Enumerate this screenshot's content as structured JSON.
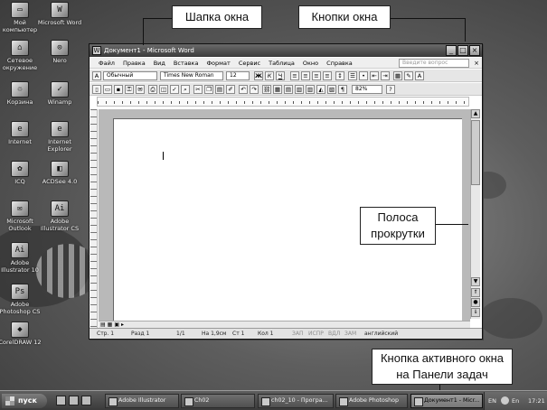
{
  "desktop": {
    "icons": [
      {
        "label": "Мой компьютер",
        "glyph": "▭"
      },
      {
        "label": "Microsoft Word",
        "glyph": "W"
      },
      {
        "label": "Сетевое окружение",
        "glyph": "⌂"
      },
      {
        "label": "Nero",
        "glyph": "⊙"
      },
      {
        "label": "Корзина",
        "glyph": "♲"
      },
      {
        "label": "Winamp",
        "glyph": "✓"
      },
      {
        "label": "Internet",
        "glyph": "e"
      },
      {
        "label": "Internet Explorer",
        "glyph": "e"
      },
      {
        "label": "ICQ",
        "glyph": "✿"
      },
      {
        "label": "ACDSee 4.0",
        "glyph": "◧"
      },
      {
        "label": "Microsoft Outlook",
        "glyph": "✉"
      },
      {
        "label": "Adobe Illustrator CS",
        "glyph": "Ai"
      },
      {
        "label": "Adobe Illustrator 10",
        "glyph": "Ai"
      },
      {
        "label": "Adobe Photoshop CS",
        "glyph": "Ps"
      },
      {
        "label": "CorelDRAW 12",
        "glyph": "◆"
      }
    ]
  },
  "window": {
    "title": "Документ1 - Microsoft Word",
    "buttons": {
      "minimize": "_",
      "maximize": "□",
      "close": "×"
    },
    "menu": [
      "Файл",
      "Правка",
      "Вид",
      "Вставка",
      "Формат",
      "Сервис",
      "Таблица",
      "Окно",
      "Справка"
    ],
    "help_placeholder": "Введите вопрос",
    "menu_close": "×",
    "formatting": {
      "style": "Обычный",
      "font": "Times New Roman",
      "size": "12",
      "bold": "Ж",
      "italic": "К",
      "underline": "Ч"
    },
    "standard": {
      "zoom": "82%"
    },
    "status": {
      "page": "Стр. 1",
      "section": "Разд 1",
      "pages": "1/1",
      "at": "На 1,9см",
      "line": "Ст 1",
      "col": "Кол 1",
      "rec": "ЗАП",
      "trk": "ИСПР",
      "ext": "ВДЛ",
      "ovr": "ЗАМ",
      "lang": "английский"
    }
  },
  "callouts": {
    "title_bar": "Шапка окна",
    "window_buttons": "Кнопки окна",
    "scrollbar_line1": "Полоса",
    "scrollbar_line2": "прокрутки",
    "taskbar_line1": "Кнопка активного окна",
    "taskbar_line2": "на Панели задач"
  },
  "taskbar": {
    "start": "пуск",
    "tasks": [
      {
        "label": "Adobe Illustrator",
        "active": false
      },
      {
        "label": "Ch02",
        "active": false
      },
      {
        "label": "ch02_10 - Програ...",
        "active": false
      },
      {
        "label": "Adobe Photoshop",
        "active": false
      },
      {
        "label": "Документ1 - Micr...",
        "active": true
      }
    ],
    "lang": "EN",
    "lang2": "En",
    "clock": "17:21"
  }
}
